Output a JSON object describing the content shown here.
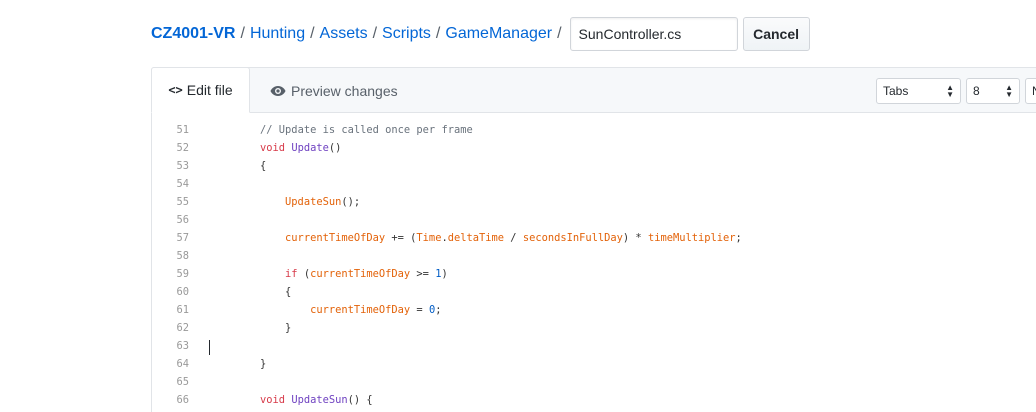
{
  "breadcrumb": {
    "repo": "CZ4001-VR",
    "path": [
      "Hunting",
      "Assets",
      "Scripts",
      "GameManager"
    ],
    "separator": "/"
  },
  "filename_input": {
    "value": "SunController.cs"
  },
  "cancel_label": "Cancel",
  "tabs": {
    "edit_label": "Edit file",
    "preview_label": "Preview changes"
  },
  "indent_mode": "Tabs",
  "indent_size": "8",
  "wrap_mode_partial": "N",
  "code_lines": [
    {
      "n": "51",
      "html": "    <span class=\"c\">// Update is called once per frame</span>"
    },
    {
      "n": "52",
      "html": "    <span class=\"k\">void</span> <span class=\"t\">Update</span>()"
    },
    {
      "n": "53",
      "html": "    {"
    },
    {
      "n": "54",
      "html": ""
    },
    {
      "n": "55",
      "html": "        <span class=\"f\">UpdateSun</span>();"
    },
    {
      "n": "56",
      "html": ""
    },
    {
      "n": "57",
      "html": "        <span class=\"v\">currentTimeOfDay</span> += (<span class=\"v\">Time</span>.<span class=\"v\">deltaTime</span> / <span class=\"v\">secondsInFullDay</span>) * <span class=\"v\">timeMultiplier</span>;"
    },
    {
      "n": "58",
      "html": ""
    },
    {
      "n": "59",
      "html": "        <span class=\"k\">if</span> (<span class=\"v\">currentTimeOfDay</span> >= <span class=\"n\">1</span>)"
    },
    {
      "n": "60",
      "html": "        {"
    },
    {
      "n": "61",
      "html": "            <span class=\"v\">currentTimeOfDay</span> = <span class=\"n\">0</span>;"
    },
    {
      "n": "62",
      "html": "        }"
    },
    {
      "n": "63",
      "html": ""
    },
    {
      "n": "64",
      "html": "    }"
    },
    {
      "n": "65",
      "html": ""
    },
    {
      "n": "66",
      "html": "    <span class=\"k\">void</span> <span class=\"t\">UpdateSun</span>() {"
    }
  ]
}
